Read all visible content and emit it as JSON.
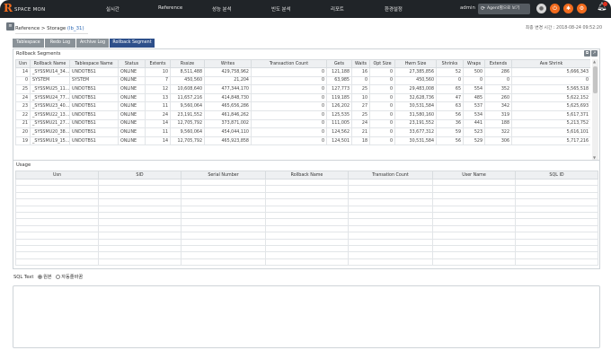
{
  "app": {
    "logo_mark": "R",
    "logo_text": "SPACE MON",
    "nav": [
      "실시간",
      "Reference",
      "성능 분석",
      "빈도 분석",
      "리포트",
      "환경설정"
    ],
    "user": "admin",
    "agent_button": "Agent별으로 보기",
    "header_icons": [
      "person-icon",
      "power-icon",
      "settings-icon",
      "gear-icon",
      "bell-icon"
    ]
  },
  "breadcrumb": {
    "prefix": "Reference > Storage",
    "suffix": "(lb_31)"
  },
  "last_update": "최종 변경 시간 : 2018-08-24 09:52:20",
  "tabs": [
    "Tablespace",
    "Redo Log",
    "Archive Log",
    "Rollback Segment"
  ],
  "rollback": {
    "title": "Rollback Segments",
    "columns": [
      "Usn",
      "Rollback Name",
      "Tablespace Name",
      "Status",
      "Extents",
      "Rssize",
      "Writes",
      "Transaction Count",
      "Gets",
      "Waits",
      "Opt Size",
      "Hwm Size",
      "Shrinks",
      "Wraps",
      "Extends",
      "Ave Shrink"
    ],
    "rows": [
      [
        "14",
        "_SYSSMU14_34...",
        "UNDOTBS1",
        "ONLINE",
        "10",
        "8,511,488",
        "429,758,962",
        "0",
        "121,188",
        "16",
        "0",
        "27,385,856",
        "52",
        "500",
        "286",
        "5,666,343"
      ],
      [
        "0",
        "SYSTEM",
        "SYSTEM",
        "ONLINE",
        "7",
        "450,560",
        "21,204",
        "0",
        "63,985",
        "0",
        "0",
        "450,560",
        "0",
        "0",
        "0",
        "0"
      ],
      [
        "25",
        "_SYSSMU25_11...",
        "UNDOTBS1",
        "ONLINE",
        "12",
        "10,608,640",
        "477,344,170",
        "0",
        "127,773",
        "25",
        "0",
        "29,483,008",
        "65",
        "554",
        "352",
        "5,565,518"
      ],
      [
        "24",
        "_SYSSMU24_77...",
        "UNDOTBS1",
        "ONLINE",
        "13",
        "11,657,216",
        "414,848,730",
        "0",
        "119,185",
        "10",
        "0",
        "32,628,736",
        "47",
        "485",
        "260",
        "5,622,152"
      ],
      [
        "23",
        "_SYSSMU23_40...",
        "UNDOTBS1",
        "ONLINE",
        "11",
        "9,560,064",
        "465,656,286",
        "0",
        "126,202",
        "27",
        "0",
        "30,531,584",
        "63",
        "537",
        "342",
        "5,625,693"
      ],
      [
        "22",
        "_SYSSMU22_13...",
        "UNDOTBS1",
        "ONLINE",
        "24",
        "23,191,552",
        "461,846,262",
        "0",
        "125,535",
        "25",
        "0",
        "31,580,160",
        "56",
        "534",
        "319",
        "5,617,371"
      ],
      [
        "21",
        "_SYSSMU21_27...",
        "UNDOTBS1",
        "ONLINE",
        "14",
        "12,705,792",
        "373,871,002",
        "0",
        "111,005",
        "24",
        "0",
        "23,191,552",
        "36",
        "441",
        "188",
        "5,213,752"
      ],
      [
        "20",
        "_SYSSMU20_38...",
        "UNDOTBS1",
        "ONLINE",
        "11",
        "9,560,064",
        "454,044,110",
        "0",
        "124,562",
        "21",
        "0",
        "33,677,312",
        "59",
        "523",
        "322",
        "5,616,101"
      ],
      [
        "19",
        "_SYSSMU19_15...",
        "UNDOTBS1",
        "ONLINE",
        "14",
        "12,705,792",
        "465,923,858",
        "0",
        "124,501",
        "18",
        "0",
        "30,531,584",
        "56",
        "529",
        "306",
        "5,717,216"
      ]
    ]
  },
  "usage": {
    "title": "Usage",
    "columns": [
      "Usn",
      "SID",
      "Serial Number",
      "Rollback Name",
      "Transation Count",
      "User Name",
      "SQL ID"
    ],
    "empty_rows": 13
  },
  "sql_text": {
    "label": "SQL Text",
    "option_original": "원본",
    "option_auto": "자동줄바꿈"
  }
}
